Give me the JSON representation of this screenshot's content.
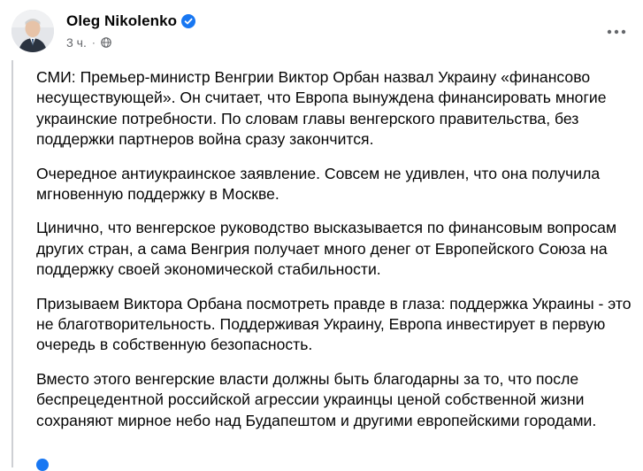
{
  "author": {
    "name": "Oleg Nikolenko",
    "time": "3 ч."
  },
  "icons": {
    "verified": "verified-badge-icon",
    "privacy": "globe-icon",
    "more": "more-options-icon"
  },
  "colors": {
    "verified_blue": "#1877f2",
    "secondary_text": "#65676b"
  },
  "post": {
    "paragraphs": [
      "СМИ: Премьер-министр Венгрии Виктор Орбан назвал Украину «финансово несуществующей». Он считает, что Европа вынуждена финансировать многие украинские потребности. По словам главы венгерского правительства, без поддержки партнеров война сразу закончится.",
      "Очередное антиукраинское заявление. Совсем не удивлен, что она получила мгновенную поддержку в Москве.",
      "Цинично, что венгерское руководство высказывается по финансовым вопросам других стран, а сама Венгрия получает много денег от Европейского Союза на поддержку своей экономической стабильности.",
      "Призываем Виктора Орбана посмотреть правде в глаза: поддержка Украины - это не благотворительность. Поддерживая Украину, Европа инвестирует в первую очередь в собственную безопасность.",
      "Вместо этого венгерские власти должны быть благодарны за то, что после беспрецедентной российской агрессии украинцы ценой собственной жизни сохраняют мирное небо над Будапештом и другими европейскими городами."
    ]
  }
}
